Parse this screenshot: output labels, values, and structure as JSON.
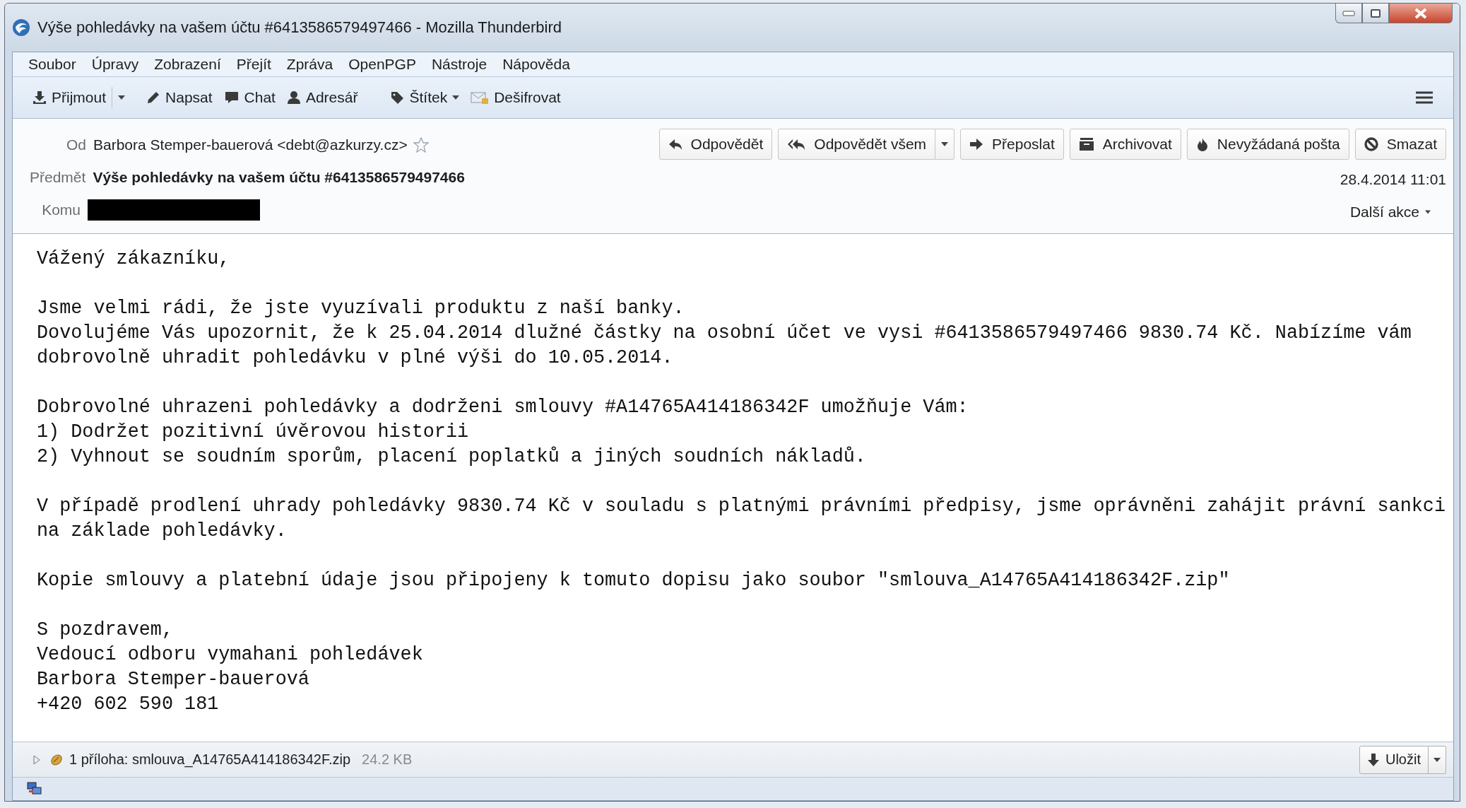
{
  "window": {
    "title": "Výše pohledávky na vašem účtu #6413586579497466 - Mozilla Thunderbird"
  },
  "menu": [
    {
      "label": "Soubor"
    },
    {
      "label": "Úpravy"
    },
    {
      "label": "Zobrazení"
    },
    {
      "label": "Přejít"
    },
    {
      "label": "Zpráva"
    },
    {
      "label": "OpenPGP"
    },
    {
      "label": "Nástroje"
    },
    {
      "label": "Nápověda"
    }
  ],
  "toolbar": [
    {
      "label": "Přijmout",
      "kind": "split"
    },
    {
      "label": "Napsat",
      "kind": "plain"
    },
    {
      "label": "Chat",
      "kind": "plain"
    },
    {
      "label": "Adresář",
      "kind": "plain"
    },
    {
      "label": "Štítek",
      "kind": "menu"
    },
    {
      "label": "Dešifrovat",
      "kind": "plain"
    }
  ],
  "header": {
    "from_label": "Od",
    "from": "Barbora Stemper-bauerová <debt@azkurzy.cz>",
    "starred": false,
    "subject_label": "Předmět",
    "subject": "Výše pohledávky na vašem účtu #6413586579497466",
    "to_label": "Komu",
    "date": "28.4.2014 11:01",
    "more_actions": "Další akce",
    "actions": [
      {
        "label": "Odpovědět",
        "kind": "plain"
      },
      {
        "label": "Odpovědět všem",
        "kind": "split"
      },
      {
        "label": "Přeposlat",
        "kind": "plain"
      },
      {
        "label": "Archivovat",
        "kind": "plain"
      },
      {
        "label": "Nevyžádaná pošta",
        "kind": "plain"
      },
      {
        "label": "Smazat",
        "kind": "plain"
      }
    ]
  },
  "body": {
    "paragraphs": [
      [
        "Vážený zákazníku,"
      ],
      [
        "Jsme velmi rádi, že jste vyuzívali produktu z naší banky.",
        "Dovolujéme Vás upozornit, že k 25.04.2014 dlužné částky na osobní účet ve vysi #6413586579497466 9830.74 Kč. Nabízíme vám dobrovolně uhradit pohledávku v plné výši do 10.05.2014."
      ],
      [
        "Dobrovolné uhrazeni pohledávky a dodrženi smlouvy #A14765A414186342F umožňuje Vám:",
        "1) Dodržet pozitivní úvěrovou historii",
        "2) Vyhnout se soudním sporům, placení poplatků a jiných soudních nákladů."
      ],
      [
        "V případě prodlení uhrady pohledávky 9830.74 Kč v souladu s platnými právními předpisy, jsme oprávněni zahájit právní sankci na základe pohledávky."
      ],
      [
        "Kopie smlouvy a platební údaje jsou připojeny k tomuto dopisu jako soubor \"smlouva_A14765A414186342F.zip\""
      ],
      [
        "S pozdravem,",
        "Vedoucí odboru vymahani pohledávek",
        "Barbora Stemper-bauerová",
        "+420 602 590 181"
      ]
    ]
  },
  "attachment": {
    "expanded": false,
    "summary": "1 příloha: smlouva_A14765A414186342F.zip",
    "size": "24.2 KB",
    "save": "Uložit"
  }
}
